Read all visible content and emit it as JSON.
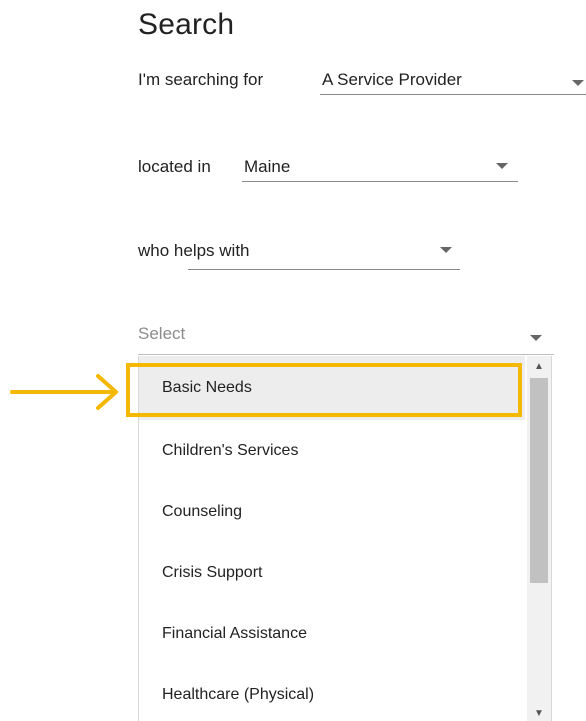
{
  "header": {
    "title": "Search"
  },
  "search_for": {
    "label": "I'm searching for",
    "value": "A Service Provider"
  },
  "location": {
    "label": "located in",
    "value": "Maine"
  },
  "helps_with": {
    "label": "who helps with",
    "value": ""
  },
  "category_select": {
    "placeholder": "Select",
    "options": [
      "Basic Needs",
      "Children's Services",
      "Counseling",
      "Crisis Support",
      "Financial Assistance",
      "Healthcare (Physical)"
    ],
    "highlighted_option": "Basic Needs"
  },
  "annotation": {
    "highlight_color": "#f5b800",
    "icon": "arrow-right-icon"
  }
}
